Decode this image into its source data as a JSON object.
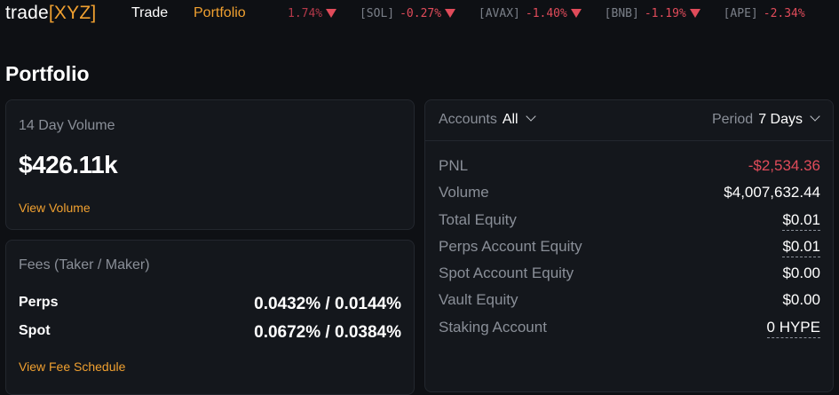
{
  "brand": {
    "prefix": "trade",
    "bracket_open": "[",
    "name": "XYZ",
    "bracket_close": "]"
  },
  "nav": {
    "trade": "Trade",
    "portfolio": "Portfolio"
  },
  "ticker": [
    {
      "symbol": "",
      "change": "1.74%"
    },
    {
      "symbol": "[SOL]",
      "change": "-0.27%"
    },
    {
      "symbol": "[AVAX]",
      "change": "-1.40%"
    },
    {
      "symbol": "[BNB]",
      "change": "-1.19%"
    },
    {
      "symbol": "[APE]",
      "change": "-2.34%"
    }
  ],
  "page": {
    "title": "Portfolio"
  },
  "volume": {
    "label": "14 Day Volume",
    "value": "$426.11k",
    "link": "View Volume"
  },
  "fees": {
    "label": "Fees (Taker / Maker)",
    "rows": [
      {
        "name": "Perps",
        "value": "0.0432% / 0.0144%"
      },
      {
        "name": "Spot",
        "value": "0.0672% / 0.0384%"
      }
    ],
    "link": "View Fee Schedule"
  },
  "accounts": {
    "accounts_label": "Accounts",
    "accounts_value": "All",
    "period_label": "Period",
    "period_value": "7 Days",
    "stats": [
      {
        "label": "PNL",
        "value": "-$2,534.36"
      },
      {
        "label": "Volume",
        "value": "$4,007,632.44"
      },
      {
        "label": "Total Equity",
        "value": "$0.01"
      },
      {
        "label": "Perps Account Equity",
        "value": "$0.01"
      },
      {
        "label": "Spot Account Equity",
        "value": "$0.00"
      },
      {
        "label": "Vault Equity",
        "value": "$0.00"
      },
      {
        "label": "Staking Account",
        "value": "0 HYPE"
      }
    ]
  },
  "colors": {
    "accent": "#f0a030",
    "negative": "#e04b5a",
    "background": "#0e1014",
    "card": "#14171c"
  }
}
